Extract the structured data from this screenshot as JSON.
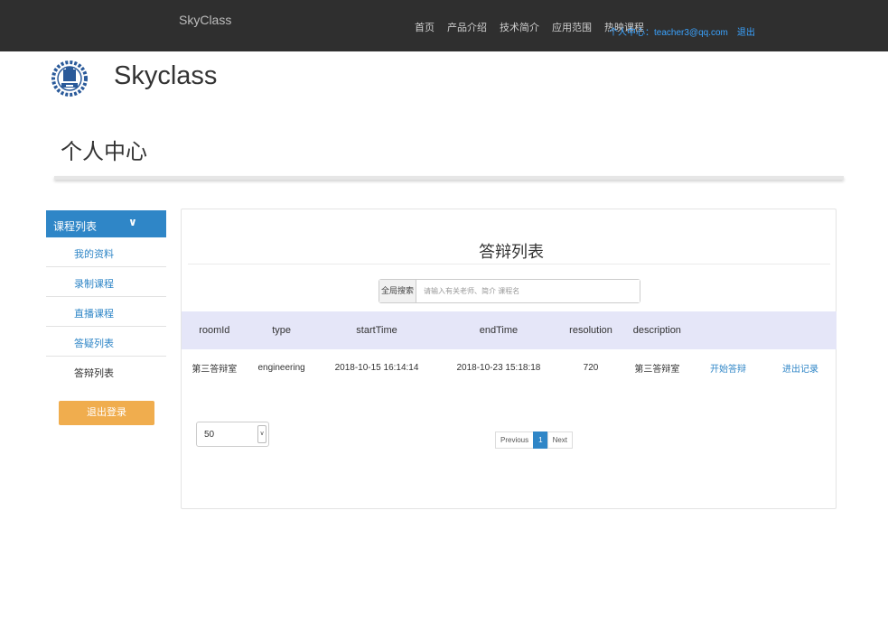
{
  "navbar": {
    "brand": "SkyClass",
    "links": [
      "首页",
      "产品介绍",
      "技术简介",
      "应用范围",
      "热映课程"
    ],
    "user_center": "个人中心：teacher3@qq.com",
    "logout": "退出"
  },
  "header": {
    "logo_text": "Skyclass",
    "page_title": "个人中心"
  },
  "sidebar": {
    "header": "课程列表",
    "items": [
      "我的资料",
      "录制课程",
      "直播课程",
      "答疑列表",
      "答辩列表"
    ],
    "logout_button": "退出登录"
  },
  "panel": {
    "title": "答辩列表",
    "search": {
      "label": "全局搜索",
      "placeholder": "请输入有关老师、简介 课程名"
    },
    "columns": [
      "roomId",
      "type",
      "startTime",
      "endTime",
      "resolution",
      "description",
      "",
      ""
    ],
    "rows": [
      {
        "roomId": "第三答辩室",
        "type": "engineering",
        "startTime": "2018-10-15 16:14:14",
        "endTime": "2018-10-23 15:18:18",
        "resolution": "720",
        "description": "第三答辩室",
        "action1": "开始答辩",
        "action2": "进出记录"
      }
    ],
    "page_size": "50",
    "pagination": {
      "previous": "Previous",
      "current": "1",
      "next": "Next"
    }
  },
  "colors": {
    "navbar_bg": "#2f2f2f",
    "primary": "#2f86c7",
    "warning": "#f0ad4e",
    "table_header_bg": "#e5e6f8"
  }
}
